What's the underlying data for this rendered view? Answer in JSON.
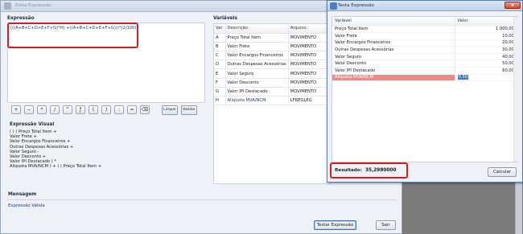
{
  "main_window": {
    "title": "Edita Expressão",
    "expressao": {
      "title": "Expressão",
      "formula": "(((A+B+C+D+E+F+G)*H) +((A+B+C+D+E+F+G)))*(2/100)"
    },
    "calc_buttons": [
      "+",
      "−",
      "*",
      "/",
      "^",
      "ƒ",
      "(",
      ")",
      ":",
      "=",
      "⌫"
    ],
    "limpar_label": "Limpar",
    "validar_label": "Validar",
    "expressao_visual": {
      "title": "Expressão Visual",
      "lines": [
        "( ( ( Preço Total Item +",
        "Valor Frete +",
        "Valor Encargos Financeiros +",
        "Outras Despesas Acessórias +",
        "Valor Seguro -",
        "Valor Desconto +",
        "Valor IPI Destacado ) *",
        "Aliquota MVA/NCM ) + ( ( Preço Total Item +"
      ]
    },
    "variaveis": {
      "title": "Variáveis",
      "columns": [
        "Var",
        "Descrição",
        "Arquivo"
      ],
      "rows": [
        [
          "A",
          "Preço Total Item",
          "MOVIMENTO"
        ],
        [
          "B",
          "Valor Frete",
          "MOVIMENTO"
        ],
        [
          "C",
          "Valor Encargos Financeiros",
          "MOVIMENTO"
        ],
        [
          "D",
          "Outras Despesas Acessórias",
          "MOVIMENTO"
        ],
        [
          "E",
          "Valor Seguro",
          "MOVIMENTO"
        ],
        [
          "F",
          "Valor Desconto",
          "MOVIMENTO"
        ],
        [
          "G",
          "Valor IPI Destacado",
          "MOVIMENTO"
        ],
        [
          "H",
          "Aliquota MVA/NCM",
          "LFREGLEG"
        ]
      ]
    },
    "mensagem": {
      "title": "Mensagem",
      "text": "Expressão Válida"
    },
    "testar_label": "Testar Expressão",
    "sair_label": "Sair"
  },
  "test_window": {
    "title": "Testa Expressão",
    "close_label": "x",
    "columns": [
      "Variável",
      "Valor"
    ],
    "rows": [
      [
        "Preço Total Item",
        "1.000,00"
      ],
      [
        "Valor Frete",
        "10,00"
      ],
      [
        "Valor Encargos Financeiros",
        "20,00"
      ],
      [
        "Outras Despesas Acessórias",
        "30,00"
      ],
      [
        "Valor Seguro",
        "40,00"
      ],
      [
        "Valor Desconto",
        "50,00"
      ],
      [
        "Valor IPI Destacado",
        "60,00"
      ],
      [
        "Aliquota MVA/NCM",
        "0,50"
      ]
    ],
    "resultado_label": "Resultado:",
    "resultado_value": "35,2980000",
    "calcular_label": "Calcular"
  },
  "colors": {
    "highlight_red": "#d11f1f",
    "row_highlight": "#f08a80",
    "selected_value": "#3b73c9"
  }
}
